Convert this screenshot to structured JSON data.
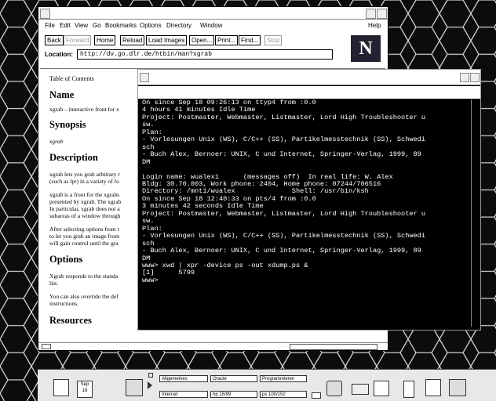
{
  "browser": {
    "menu": [
      "File",
      "Edit",
      "View",
      "Go",
      "Bookmarks",
      "Options",
      "Directory",
      "Window"
    ],
    "help": "Help",
    "toolbar": {
      "back": "Back",
      "forward": "Forward",
      "home": "Home",
      "reload": "Reload",
      "load_images": "Load Images",
      "open": "Open...",
      "print": "Print...",
      "find": "Find...",
      "stop": "Stop"
    },
    "location_label": "Location:",
    "location_url": "http://dv.go.dlr.de/htbin/man?xgrab",
    "logo_letter": "N",
    "content": {
      "toc": "Table of Contents",
      "name_h": "Name",
      "name_p": "xgrab – interactive front for x",
      "synopsis_h": "Synopsis",
      "synopsis_p": "xgrab",
      "description_h": "Description",
      "desc_p1": [
        "xgrab lets you grab arbitrary r",
        "(such as lpr) in a variety of fo"
      ],
      "desc_p2": [
        "xgrab is a front for the xgrabs",
        "presented by xgrab. The xgrab",
        "In particular, xgrab does not a",
        "subareas of a window through"
      ],
      "desc_p3": [
        "After selecting options from t",
        "to let you grab an image from",
        "will gain control until the gra"
      ],
      "options_h": "Options",
      "opt_p1": [
        "Xgrab responds to the standa",
        "list."
      ],
      "opt_p2": [
        "You can also override the def",
        "instructions."
      ],
      "resources_h": "Resources"
    }
  },
  "terminal": {
    "lines": [
      "On since Sep 18 09:26:13 on ttyp4 from :0.0",
      "4 hours 41 minutes Idle Time",
      "Project: Postmaster, Webmaster, Listmaster, Lord High Troubleshooter u",
      "sw.",
      "Plan:",
      "- Vorlesungen Unix (WS), C/C++ (SS), Partikelmesstechnik (SS), Schwedi",
      "sch",
      "- Buch Alex, Bernoer: UNIX, C und Internet, Springer-Verlag, 1999, 89",
      "DM",
      "",
      "Login name: wualex1      (messages off)  In real life: W. Alex",
      "Bldg: 30.70.003, Work phone: 2404, Home phone: 07244/706516",
      "Directory: /mnt1/wualex              Shell: /usr/bin/ksh",
      "On since Sep 18 12:40:33 on pts/4 from :0.0",
      "3 minutes 42 seconds Idle Time",
      "Project: Postmaster, Webmaster, Listmaster, Lord High Troubleshooter u",
      "sw.",
      "Plan:",
      "- Vorlesungen Unix (WS), C/C++ (SS), Partikelmesstechnik (SS), Schwedi",
      "sch",
      "- Buch Alex, Bernoer: UNIX, C und Internet, Springer-Verlag, 1999, 89",
      "DM",
      "www> xwd | xpr -device ps -out xdump.ps &",
      "[1]      5799",
      "www>"
    ]
  },
  "taskbar": {
    "date_month": "Sep",
    "date_day": "18",
    "tabs": {
      "allgemeines": "Allgemeines",
      "oracle": "Oracle",
      "programmieren": "Programmieren",
      "internet": "Internet",
      "hp": "hp 15/99",
      "ps": "ps 100/152"
    }
  },
  "colors": {
    "desktop": "#111111",
    "terminal_bg": "#000000",
    "terminal_fg": "#ffffff"
  }
}
